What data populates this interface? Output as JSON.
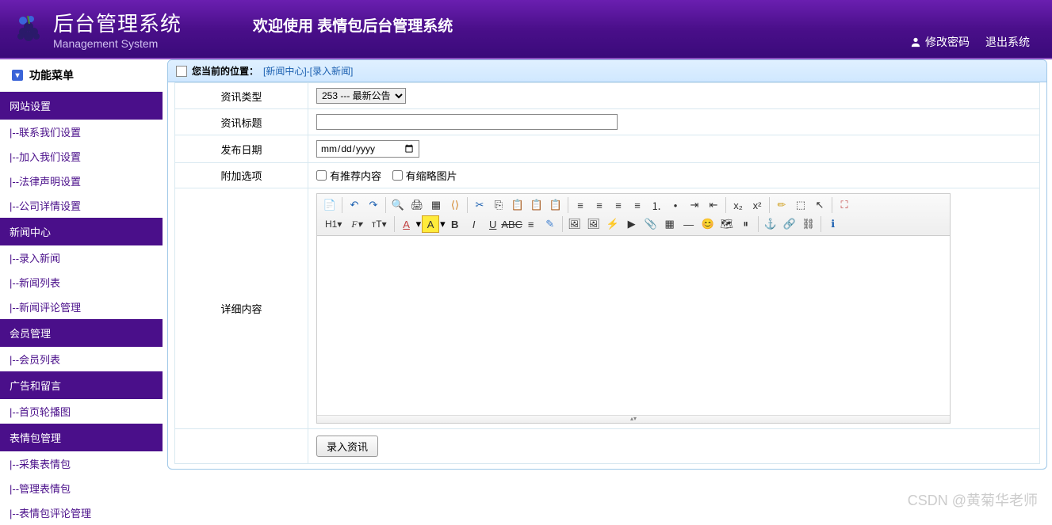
{
  "header": {
    "title_cn": "后台管理系统",
    "title_en": "Management System",
    "welcome": "欢迎使用 表情包后台管理系统",
    "change_pwd": "修改密码",
    "logout": "退出系统"
  },
  "sidebar": {
    "menu_title": "功能菜单",
    "groups": [
      {
        "label": "网站设置",
        "items": [
          "|--联系我们设置",
          "|--加入我们设置",
          "|--法律声明设置",
          "|--公司详情设置"
        ]
      },
      {
        "label": "新闻中心",
        "items": [
          "|--录入新闻",
          "|--新闻列表",
          "|--新闻评论管理"
        ]
      },
      {
        "label": "会员管理",
        "items": [
          "|--会员列表"
        ]
      },
      {
        "label": "广告和留言",
        "items": [
          "|--首页轮播图"
        ]
      },
      {
        "label": "表情包管理",
        "items": [
          "|--采集表情包",
          "|--管理表情包",
          "|--表情包评论管理"
        ]
      }
    ]
  },
  "breadcrumb": {
    "label": "您当前的位置：",
    "path": "[新闻中心]-[录入新闻]"
  },
  "form": {
    "type_label": "资讯类型",
    "type_value": "253 --- 最新公告",
    "title_label": "资讯标题",
    "title_value": "",
    "date_label": "发布日期",
    "date_placeholder": "年 /月/日",
    "options_label": "附加选项",
    "opt_recommend": "有推荐内容",
    "opt_thumb": "有缩略图片",
    "content_label": "详细内容",
    "submit": "录入资讯"
  },
  "editor_toolbar": {
    "h1": "H1",
    "font_family": "F",
    "font_size": "тT"
  },
  "watermark": "CSDN @黄菊华老师"
}
